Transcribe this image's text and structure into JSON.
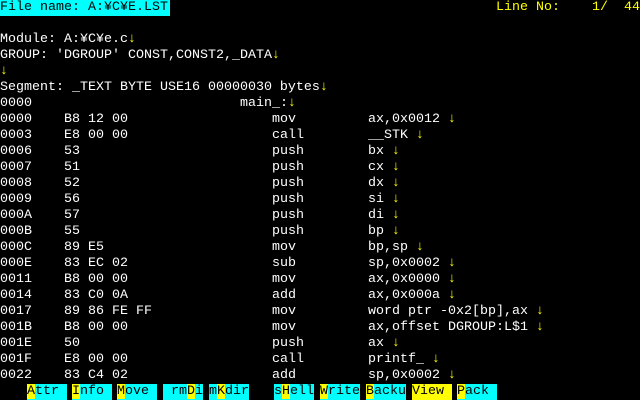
{
  "header": {
    "file_name": "File name: A:¥C¥E.LST",
    "line_no_label": "Line No:",
    "line_no_value": "1/  44"
  },
  "preamble": [
    {
      "text": "Module: A:¥C¥e.c",
      "arrow": "↓"
    },
    {
      "text": "GROUP: 'DGROUP' CONST,CONST2,_DATA",
      "arrow": "↓"
    },
    {
      "text": "",
      "arrow": "↓"
    },
    {
      "text": "Segment: _TEXT BYTE USE16 00000030 bytes",
      "arrow": "↓"
    }
  ],
  "label_line": {
    "addr": "0000",
    "label": "main_:",
    "arrow": "↓"
  },
  "code": [
    {
      "addr": "0000",
      "bytes": "B8 12 00",
      "op": "mov",
      "args": "ax,0x0012"
    },
    {
      "addr": "0003",
      "bytes": "E8 00 00",
      "op": "call",
      "args": "__STK"
    },
    {
      "addr": "0006",
      "bytes": "53",
      "op": "push",
      "args": "bx"
    },
    {
      "addr": "0007",
      "bytes": "51",
      "op": "push",
      "args": "cx"
    },
    {
      "addr": "0008",
      "bytes": "52",
      "op": "push",
      "args": "dx"
    },
    {
      "addr": "0009",
      "bytes": "56",
      "op": "push",
      "args": "si"
    },
    {
      "addr": "000A",
      "bytes": "57",
      "op": "push",
      "args": "di"
    },
    {
      "addr": "000B",
      "bytes": "55",
      "op": "push",
      "args": "bp"
    },
    {
      "addr": "000C",
      "bytes": "89 E5",
      "op": "mov",
      "args": "bp,sp"
    },
    {
      "addr": "000E",
      "bytes": "83 EC 02",
      "op": "sub",
      "args": "sp,0x0002"
    },
    {
      "addr": "0011",
      "bytes": "B8 00 00",
      "op": "mov",
      "args": "ax,0x0000"
    },
    {
      "addr": "0014",
      "bytes": "83 C0 0A",
      "op": "add",
      "args": "ax,0x000a"
    },
    {
      "addr": "0017",
      "bytes": "89 86 FE FF",
      "op": "mov",
      "args": "word ptr -0x2[bp],ax"
    },
    {
      "addr": "001B",
      "bytes": "B8 00 00",
      "op": "mov",
      "args": "ax,offset DGROUP:L$1"
    },
    {
      "addr": "001E",
      "bytes": "50",
      "op": "push",
      "args": "ax"
    },
    {
      "addr": "001F",
      "bytes": "E8 00 00",
      "op": "call",
      "args": "printf_"
    },
    {
      "addr": "0022",
      "bytes": "83 C4 02",
      "op": "add",
      "args": "sp,0x0002"
    }
  ],
  "code_arrow": " ↓",
  "function_keys": [
    {
      "pre": "",
      "key": "A",
      "post": "ttr"
    },
    {
      "pre": "",
      "key": "I",
      "post": "nfo"
    },
    {
      "pre": "",
      "key": "M",
      "post": "ove"
    },
    {
      "pre": " rm",
      "key": "D",
      "post": "ir"
    },
    {
      "pre": "m",
      "key": "K",
      "post": "dir"
    },
    {
      "pre": "s",
      "key": "H",
      "post": "ell"
    },
    {
      "pre": "",
      "key": "W",
      "post": "rite"
    },
    {
      "pre": "",
      "key": "B",
      "post": "ackup"
    },
    {
      "pre": "",
      "key": "V",
      "post": "iew",
      "selected": true
    },
    {
      "pre": "",
      "key": "P",
      "post": "ack"
    }
  ],
  "colors": {
    "cyan": "#00ffff",
    "yellow": "#ffff00",
    "text": "#ffffff",
    "background": "#000000"
  }
}
